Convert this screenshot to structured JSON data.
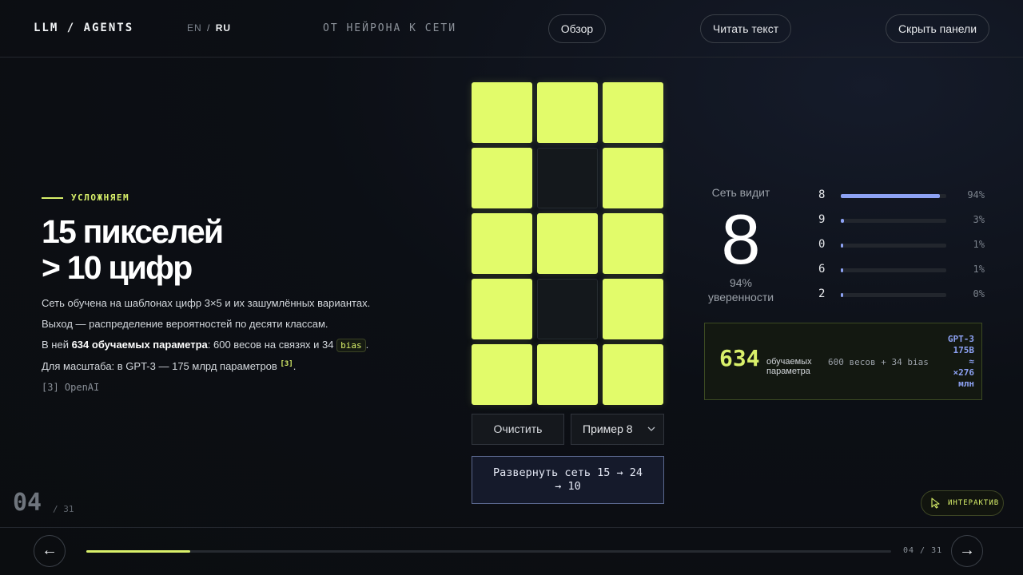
{
  "header": {
    "brand": "LLM / AGENTS",
    "lang_en": "EN",
    "lang_sep": "/",
    "lang_ru": "RU",
    "section_title": "ОТ НЕЙРОНА К СЕТИ",
    "overview_label": "Обзор",
    "read_text_label": "Читать текст",
    "hide_panels_label": "Скрыть панели"
  },
  "content": {
    "eyebrow": "УСЛОЖНЯЕМ",
    "headline_line1": "15 пикселей",
    "headline_line2": "> 10 цифр",
    "para1": "Сеть обучена на шаблонах цифр 3×5 и их зашумлённых вариантах.",
    "para2": "Выход — распределение вероятностей по десяти классам.",
    "para3_prefix": "В ней ",
    "para3_bold": "634 обучаемых параметра",
    "para3_mid": ": 600 весов на связях и 34 ",
    "para3_code": "bias",
    "para3_suffix": ".",
    "para4_text": "Для масштаба: в GPT-3 — 175 млрд параметров ",
    "para4_sup": "[3]",
    "para4_suffix": ".",
    "reference": "[3]  OpenAI"
  },
  "slide": {
    "current": "04",
    "total": "/ 31"
  },
  "grid": {
    "cells": [
      1,
      1,
      1,
      1,
      0,
      1,
      1,
      1,
      1,
      1,
      0,
      1,
      1,
      1,
      1
    ],
    "on_color": "#e2fb6a"
  },
  "controls": {
    "clear_label": "Очистить",
    "example_selected": "Пример 8",
    "expand_line1": "Развернуть сеть 15 → 24",
    "expand_line2": "→ 10"
  },
  "prediction": {
    "sees_label": "Сеть видит",
    "digit": "8",
    "confidence_pct": "94%",
    "confidence_label": "уверенности",
    "probs": [
      {
        "digit": "8",
        "value": 0.94,
        "label": "94%"
      },
      {
        "digit": "9",
        "value": 0.03,
        "label": "3%"
      },
      {
        "digit": "0",
        "value": 0.01,
        "label": "1%"
      },
      {
        "digit": "6",
        "value": 0.01,
        "label": "1%"
      },
      {
        "digit": "2",
        "value": 0.0,
        "label": "0%"
      }
    ],
    "bar_color": "#8da2f4"
  },
  "params": {
    "count": "634",
    "label_line1": "обучаемых",
    "label_line2": "параметра",
    "breakdown": "600 весов + 34 bias",
    "cmp_line1": "GPT-3",
    "cmp_line2": "175B",
    "cmp_line3": "≈",
    "cmp_line4": "×276",
    "cmp_line5": "млн"
  },
  "interactive_label": "ИНТЕРАКТИВ",
  "footer": {
    "progress": 0.129,
    "count": "04 / 31",
    "prev_icon": "←",
    "next_icon": "→"
  }
}
